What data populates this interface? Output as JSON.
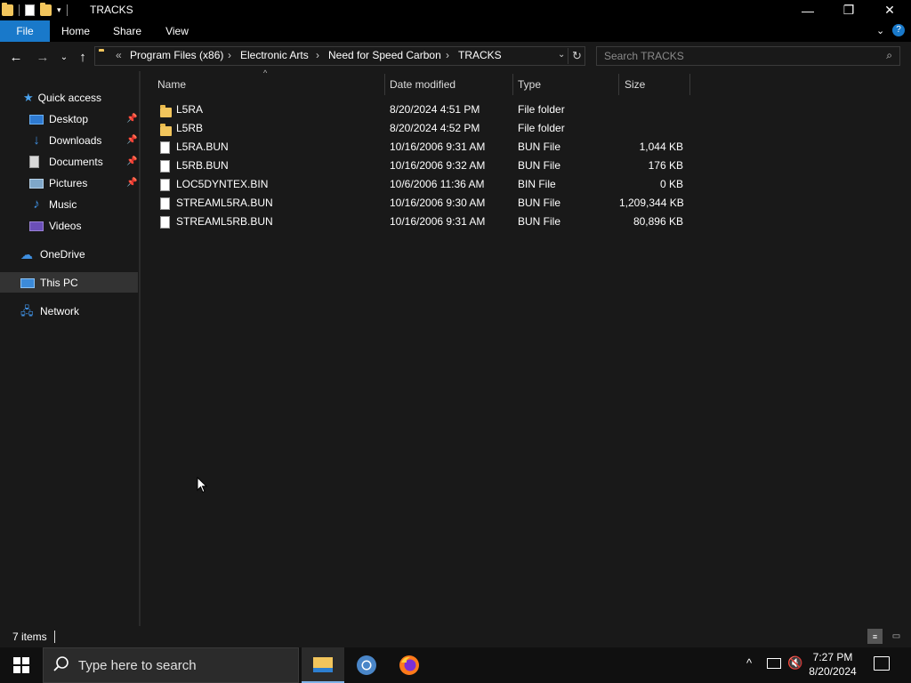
{
  "window": {
    "title": "TRACKS",
    "controls": {
      "minimize": "—",
      "restore": "❐",
      "close": "✕"
    }
  },
  "ribbon": {
    "tabs": [
      "File",
      "Home",
      "Share",
      "View"
    ]
  },
  "address": {
    "overflow": "«",
    "crumbs": [
      "Program Files (x86)",
      "Electronic Arts",
      "Need for Speed Carbon",
      "TRACKS"
    ]
  },
  "search": {
    "placeholder": "Search TRACKS"
  },
  "sidebar": {
    "quick_access": "Quick access",
    "items": [
      {
        "label": "Desktop",
        "icon": "desktop-icon",
        "pinned": true
      },
      {
        "label": "Downloads",
        "icon": "downloads-icon",
        "pinned": true
      },
      {
        "label": "Documents",
        "icon": "documents-icon",
        "pinned": true
      },
      {
        "label": "Pictures",
        "icon": "pictures-icon",
        "pinned": true
      },
      {
        "label": "Music",
        "icon": "music-icon",
        "pinned": false
      },
      {
        "label": "Videos",
        "icon": "videos-icon",
        "pinned": false
      }
    ],
    "onedrive": "OneDrive",
    "this_pc": "This PC",
    "network": "Network"
  },
  "columns": {
    "name": "Name",
    "date": "Date modified",
    "type": "Type",
    "size": "Size"
  },
  "files": [
    {
      "name": "L5RA",
      "date": "8/20/2024 4:51 PM",
      "type": "File folder",
      "size": "",
      "kind": "folder"
    },
    {
      "name": "L5RB",
      "date": "8/20/2024 4:52 PM",
      "type": "File folder",
      "size": "",
      "kind": "folder"
    },
    {
      "name": "L5RA.BUN",
      "date": "10/16/2006 9:31 AM",
      "type": "BUN File",
      "size": "1,044 KB",
      "kind": "file"
    },
    {
      "name": "L5RB.BUN",
      "date": "10/16/2006 9:32 AM",
      "type": "BUN File",
      "size": "176 KB",
      "kind": "file"
    },
    {
      "name": "LOC5DYNTEX.BIN",
      "date": "10/6/2006 11:36 AM",
      "type": "BIN File",
      "size": "0 KB",
      "kind": "file"
    },
    {
      "name": "STREAML5RA.BUN",
      "date": "10/16/2006 9:30 AM",
      "type": "BUN File",
      "size": "1,209,344 KB",
      "kind": "file"
    },
    {
      "name": "STREAML5RB.BUN",
      "date": "10/16/2006 9:31 AM",
      "type": "BUN File",
      "size": "80,896 KB",
      "kind": "file"
    }
  ],
  "status": {
    "item_count": "7 items"
  },
  "taskbar": {
    "search_placeholder": "Type here to search",
    "time": "7:27 PM",
    "date": "8/20/2024"
  },
  "colors": {
    "accent": "#1979ca",
    "folder": "#f2c55c",
    "background": "#191919"
  }
}
